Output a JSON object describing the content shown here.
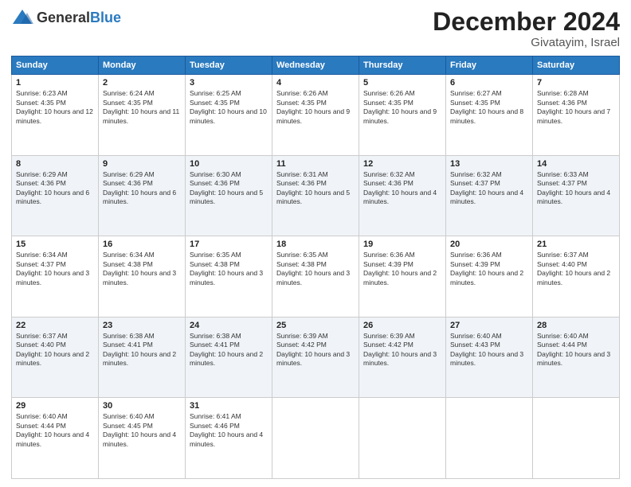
{
  "header": {
    "logo_general": "General",
    "logo_blue": "Blue",
    "month_title": "December 2024",
    "location": "Givatayim, Israel"
  },
  "days_of_week": [
    "Sunday",
    "Monday",
    "Tuesday",
    "Wednesday",
    "Thursday",
    "Friday",
    "Saturday"
  ],
  "weeks": [
    [
      {
        "day": "1",
        "sunrise": "6:23 AM",
        "sunset": "4:35 PM",
        "daylight": "10 hours and 12 minutes."
      },
      {
        "day": "2",
        "sunrise": "6:24 AM",
        "sunset": "4:35 PM",
        "daylight": "10 hours and 11 minutes."
      },
      {
        "day": "3",
        "sunrise": "6:25 AM",
        "sunset": "4:35 PM",
        "daylight": "10 hours and 10 minutes."
      },
      {
        "day": "4",
        "sunrise": "6:26 AM",
        "sunset": "4:35 PM",
        "daylight": "10 hours and 9 minutes."
      },
      {
        "day": "5",
        "sunrise": "6:26 AM",
        "sunset": "4:35 PM",
        "daylight": "10 hours and 9 minutes."
      },
      {
        "day": "6",
        "sunrise": "6:27 AM",
        "sunset": "4:35 PM",
        "daylight": "10 hours and 8 minutes."
      },
      {
        "day": "7",
        "sunrise": "6:28 AM",
        "sunset": "4:36 PM",
        "daylight": "10 hours and 7 minutes."
      }
    ],
    [
      {
        "day": "8",
        "sunrise": "6:29 AM",
        "sunset": "4:36 PM",
        "daylight": "10 hours and 6 minutes."
      },
      {
        "day": "9",
        "sunrise": "6:29 AM",
        "sunset": "4:36 PM",
        "daylight": "10 hours and 6 minutes."
      },
      {
        "day": "10",
        "sunrise": "6:30 AM",
        "sunset": "4:36 PM",
        "daylight": "10 hours and 5 minutes."
      },
      {
        "day": "11",
        "sunrise": "6:31 AM",
        "sunset": "4:36 PM",
        "daylight": "10 hours and 5 minutes."
      },
      {
        "day": "12",
        "sunrise": "6:32 AM",
        "sunset": "4:36 PM",
        "daylight": "10 hours and 4 minutes."
      },
      {
        "day": "13",
        "sunrise": "6:32 AM",
        "sunset": "4:37 PM",
        "daylight": "10 hours and 4 minutes."
      },
      {
        "day": "14",
        "sunrise": "6:33 AM",
        "sunset": "4:37 PM",
        "daylight": "10 hours and 4 minutes."
      }
    ],
    [
      {
        "day": "15",
        "sunrise": "6:34 AM",
        "sunset": "4:37 PM",
        "daylight": "10 hours and 3 minutes."
      },
      {
        "day": "16",
        "sunrise": "6:34 AM",
        "sunset": "4:38 PM",
        "daylight": "10 hours and 3 minutes."
      },
      {
        "day": "17",
        "sunrise": "6:35 AM",
        "sunset": "4:38 PM",
        "daylight": "10 hours and 3 minutes."
      },
      {
        "day": "18",
        "sunrise": "6:35 AM",
        "sunset": "4:38 PM",
        "daylight": "10 hours and 3 minutes."
      },
      {
        "day": "19",
        "sunrise": "6:36 AM",
        "sunset": "4:39 PM",
        "daylight": "10 hours and 2 minutes."
      },
      {
        "day": "20",
        "sunrise": "6:36 AM",
        "sunset": "4:39 PM",
        "daylight": "10 hours and 2 minutes."
      },
      {
        "day": "21",
        "sunrise": "6:37 AM",
        "sunset": "4:40 PM",
        "daylight": "10 hours and 2 minutes."
      }
    ],
    [
      {
        "day": "22",
        "sunrise": "6:37 AM",
        "sunset": "4:40 PM",
        "daylight": "10 hours and 2 minutes."
      },
      {
        "day": "23",
        "sunrise": "6:38 AM",
        "sunset": "4:41 PM",
        "daylight": "10 hours and 2 minutes."
      },
      {
        "day": "24",
        "sunrise": "6:38 AM",
        "sunset": "4:41 PM",
        "daylight": "10 hours and 2 minutes."
      },
      {
        "day": "25",
        "sunrise": "6:39 AM",
        "sunset": "4:42 PM",
        "daylight": "10 hours and 3 minutes."
      },
      {
        "day": "26",
        "sunrise": "6:39 AM",
        "sunset": "4:42 PM",
        "daylight": "10 hours and 3 minutes."
      },
      {
        "day": "27",
        "sunrise": "6:40 AM",
        "sunset": "4:43 PM",
        "daylight": "10 hours and 3 minutes."
      },
      {
        "day": "28",
        "sunrise": "6:40 AM",
        "sunset": "4:44 PM",
        "daylight": "10 hours and 3 minutes."
      }
    ],
    [
      {
        "day": "29",
        "sunrise": "6:40 AM",
        "sunset": "4:44 PM",
        "daylight": "10 hours and 4 minutes."
      },
      {
        "day": "30",
        "sunrise": "6:40 AM",
        "sunset": "4:45 PM",
        "daylight": "10 hours and 4 minutes."
      },
      {
        "day": "31",
        "sunrise": "6:41 AM",
        "sunset": "4:46 PM",
        "daylight": "10 hours and 4 minutes."
      },
      null,
      null,
      null,
      null
    ]
  ]
}
